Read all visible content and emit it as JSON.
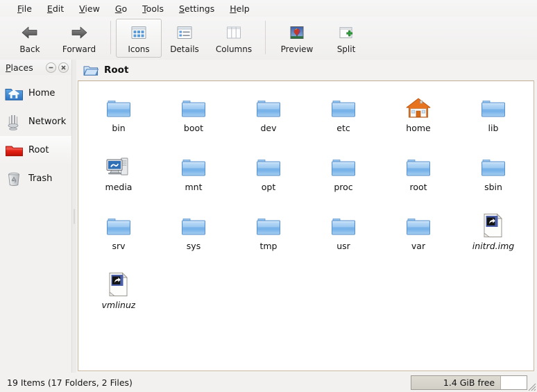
{
  "menubar": {
    "items": [
      {
        "label": "File",
        "accel": "F"
      },
      {
        "label": "Edit",
        "accel": "E"
      },
      {
        "label": "View",
        "accel": "V"
      },
      {
        "label": "Go",
        "accel": "G"
      },
      {
        "label": "Tools",
        "accel": "T"
      },
      {
        "label": "Settings",
        "accel": "S"
      },
      {
        "label": "Help",
        "accel": "H"
      }
    ]
  },
  "toolbar": {
    "buttons": [
      {
        "label": "Back",
        "icon": "arrow-left-icon",
        "active": false
      },
      {
        "label": "Forward",
        "icon": "arrow-right-icon",
        "active": false
      },
      {
        "label": "Icons",
        "icon": "icons-view-icon",
        "active": true
      },
      {
        "label": "Details",
        "icon": "details-view-icon",
        "active": false
      },
      {
        "label": "Columns",
        "icon": "columns-view-icon",
        "active": false
      },
      {
        "label": "Preview",
        "icon": "preview-icon",
        "active": false
      },
      {
        "label": "Split",
        "icon": "split-view-icon",
        "active": false
      }
    ]
  },
  "sidebar": {
    "title": "Places",
    "title_accel": "P",
    "minimize_label": "–",
    "close_label": "×",
    "items": [
      {
        "label": "Home",
        "icon": "home-folder-icon",
        "selected": false
      },
      {
        "label": "Network",
        "icon": "network-icon",
        "selected": false
      },
      {
        "label": "Root",
        "icon": "root-folder-icon",
        "selected": true
      },
      {
        "label": "Trash",
        "icon": "trash-icon",
        "selected": false
      }
    ]
  },
  "breadcrumb": {
    "icon": "open-folder-icon",
    "label": "Root"
  },
  "files": {
    "items": [
      {
        "name": "bin",
        "type": "folder",
        "icon": "folder-icon"
      },
      {
        "name": "boot",
        "type": "folder",
        "icon": "folder-icon"
      },
      {
        "name": "dev",
        "type": "folder",
        "icon": "folder-icon"
      },
      {
        "name": "etc",
        "type": "folder",
        "icon": "folder-icon"
      },
      {
        "name": "home",
        "type": "folder",
        "icon": "home-house-icon"
      },
      {
        "name": "lib",
        "type": "folder",
        "icon": "folder-icon"
      },
      {
        "name": "media",
        "type": "folder",
        "icon": "computer-media-icon"
      },
      {
        "name": "mnt",
        "type": "folder",
        "icon": "folder-icon"
      },
      {
        "name": "opt",
        "type": "folder",
        "icon": "folder-icon"
      },
      {
        "name": "proc",
        "type": "folder",
        "icon": "folder-icon"
      },
      {
        "name": "root",
        "type": "folder",
        "icon": "folder-icon"
      },
      {
        "name": "sbin",
        "type": "folder",
        "icon": "folder-icon"
      },
      {
        "name": "srv",
        "type": "folder",
        "icon": "folder-icon"
      },
      {
        "name": "sys",
        "type": "folder",
        "icon": "folder-icon"
      },
      {
        "name": "tmp",
        "type": "folder",
        "icon": "folder-icon"
      },
      {
        "name": "usr",
        "type": "folder",
        "icon": "folder-icon"
      },
      {
        "name": "var",
        "type": "folder",
        "icon": "folder-icon"
      },
      {
        "name": "initrd.img",
        "type": "symlink",
        "icon": "symlink-file-icon"
      },
      {
        "name": "vmlinuz",
        "type": "symlink",
        "icon": "symlink-file-icon"
      }
    ]
  },
  "statusbar": {
    "status": "19 Items (17 Folders, 2 Files)",
    "free_space": "1.4 GiB free",
    "free_fill_percent": 78
  },
  "colors": {
    "window_bg": "#f2f1f0",
    "content_bg": "#ffffff",
    "content_border": "#c9b99f",
    "folder_blue": "#7eb3e8",
    "root_red": "#e02b20",
    "home_orange": "#e8731e"
  }
}
